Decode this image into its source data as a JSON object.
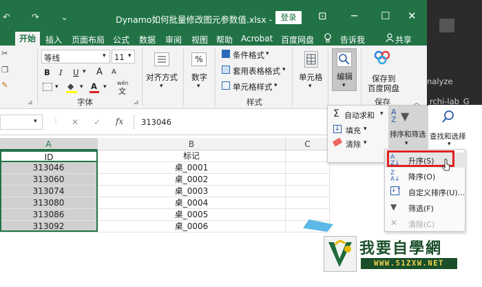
{
  "titlebar": {
    "quick_access": [
      "↶",
      "↷",
      "⌄"
    ],
    "title": "Dynamo如何批量修改图元参数值.xlsx  -  Excel",
    "login_label": "登录",
    "window_controls": [
      "⊡",
      "─",
      "☐",
      "✕"
    ]
  },
  "tabs": [
    "开始",
    "插入",
    "页面布局",
    "公式",
    "数据",
    "审阅",
    "视图",
    "帮助",
    "Acrobat",
    "百度网盘",
    "告诉我",
    "共享"
  ],
  "ribbon": {
    "font_name": "等线",
    "font_size": "11",
    "bold": "B",
    "italic": "I",
    "underline": "U",
    "grow_font": "A",
    "shrink_font": "A",
    "phonetic": "wén",
    "font_group_label": "字体",
    "align_label": "对齐方式",
    "number_label": "数字",
    "percent": "%",
    "cond_format": "条件格式",
    "table_format": "套用表格格式",
    "cell_style": "单元格样式",
    "styles_group_label": "样式",
    "cells_label": "单元格",
    "editing_label": "编辑",
    "save_to_cloud_line1": "保存到",
    "save_to_cloud_line2": "百度网盘",
    "save_group_label": "保存"
  },
  "right_strip": {
    "text1": "nalyze",
    "text2": "rchi-lab_G"
  },
  "formula_bar": {
    "cancel": "✕",
    "enter": "✓",
    "fx": "fx",
    "value": "313046"
  },
  "columns": [
    "A",
    "B",
    "C"
  ],
  "header_row": {
    "a": "ID",
    "b": "标记"
  },
  "rows": [
    {
      "a": "313046",
      "b": "桌_0001"
    },
    {
      "a": "313060",
      "b": "桌_0002"
    },
    {
      "a": "313074",
      "b": "桌_0003"
    },
    {
      "a": "313080",
      "b": "桌_0004"
    },
    {
      "a": "313086",
      "b": "桌_0005"
    },
    {
      "a": "313092",
      "b": "桌_0006"
    }
  ],
  "editing_panel": {
    "autosum": "自动求和",
    "fill": "填充",
    "clear": "清除",
    "sort_filter_label": "排序和筛选",
    "find_select_label": "查找和选择"
  },
  "sort_menu": {
    "items": [
      {
        "label": "升序(S)",
        "icon": "sort-ascending-icon"
      },
      {
        "label": "降序(O)",
        "icon": "sort-descending-icon"
      },
      {
        "label": "自定义排序(U)...",
        "icon": "custom-sort-icon"
      },
      {
        "label": "筛选(F)",
        "icon": "filter-icon"
      },
      {
        "label": "清除(C)",
        "icon": "clear-filter-icon"
      }
    ]
  },
  "watermark": {
    "title": "我要自學網",
    "url": "WWW.51ZXW.NET"
  },
  "colors": {
    "excel_green": "#217346",
    "highlight_red": "#e02020",
    "selected_cell": "#d0d0d0"
  }
}
